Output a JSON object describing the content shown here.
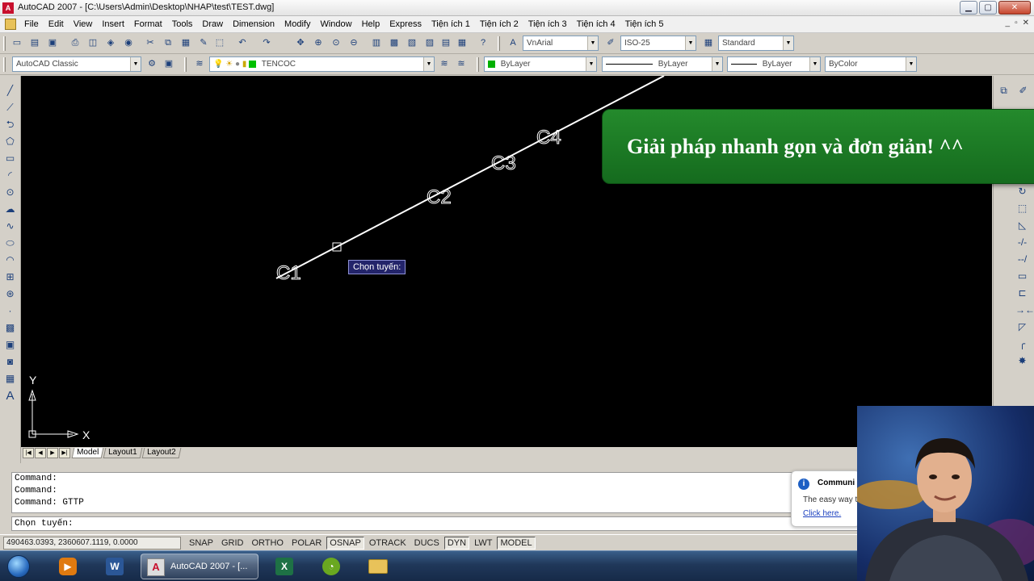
{
  "window": {
    "title": "AutoCAD 2007 - [C:\\Users\\Admin\\Desktop\\NHAP\\test\\TEST.dwg]",
    "app_icon_text": "A"
  },
  "menu": [
    "File",
    "Edit",
    "View",
    "Insert",
    "Format",
    "Tools",
    "Draw",
    "Dimension",
    "Modify",
    "Window",
    "Help",
    "Express",
    "Tiện ích 1",
    "Tiện ích 2",
    "Tiện ích 3",
    "Tiện ích 4",
    "Tiện ích 5"
  ],
  "toolbar1": {
    "text_style": "VnArial",
    "dim_style": "ISO-25",
    "table_style": "Standard"
  },
  "toolbar2": {
    "workspace": "AutoCAD Classic",
    "layer": "TENCOC",
    "color": "ByLayer",
    "linetype": "ByLayer",
    "lineweight": "ByLayer",
    "plotstyle": "ByColor",
    "color_swatch": "#00b000"
  },
  "canvas": {
    "labels": [
      "C1",
      "C2",
      "C3",
      "C4"
    ],
    "tooltip": "Chọn tuyến:",
    "ucs_x": "X",
    "ucs_y": "Y"
  },
  "tabs": [
    "Model",
    "Layout1",
    "Layout2"
  ],
  "command": {
    "history": [
      "Command:",
      "Command:",
      "Command: GTTP"
    ],
    "prompt": "Chọn tuyến:"
  },
  "status": {
    "coords": "490463.0393, 2360607.1119, 0.0000",
    "buttons": [
      {
        "label": "SNAP",
        "on": false
      },
      {
        "label": "GRID",
        "on": false
      },
      {
        "label": "ORTHO",
        "on": false
      },
      {
        "label": "POLAR",
        "on": false
      },
      {
        "label": "OSNAP",
        "on": true
      },
      {
        "label": "OTRACK",
        "on": false
      },
      {
        "label": "DUCS",
        "on": false
      },
      {
        "label": "DYN",
        "on": true
      },
      {
        "label": "LWT",
        "on": false
      },
      {
        "label": "MODEL",
        "on": true
      }
    ]
  },
  "notification": {
    "title": "Communi",
    "text": "The easy way t",
    "link": "Click here."
  },
  "banner": {
    "text": "Giải pháp nhanh gọn và đơn giản! ^^"
  },
  "taskbar": {
    "active_app": "AutoCAD 2007 - [..."
  },
  "colors": {
    "canvas_bg": "#000000",
    "banner_bg": "#1e7d26",
    "tooltip_bg": "#23246a"
  }
}
